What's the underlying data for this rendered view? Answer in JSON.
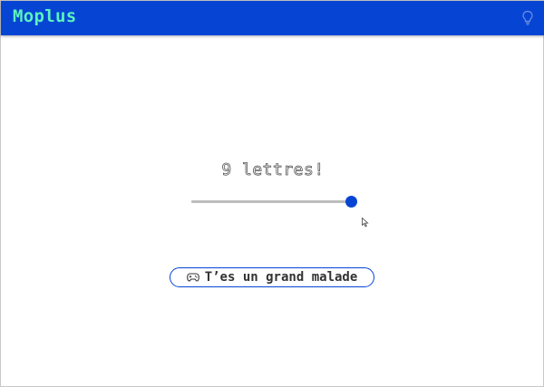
{
  "app": {
    "title": "Moplus"
  },
  "header": {
    "hint_icon": "lightbulb-icon"
  },
  "setup": {
    "letters_label": "9 lettres!",
    "letters_count": 9,
    "slider_fraction": 1.0
  },
  "play_button": {
    "icon": "gamepad-icon",
    "label": "T’es un grand malade"
  },
  "colors": {
    "accent": "#0645d4",
    "title": "#5cf0c0"
  }
}
